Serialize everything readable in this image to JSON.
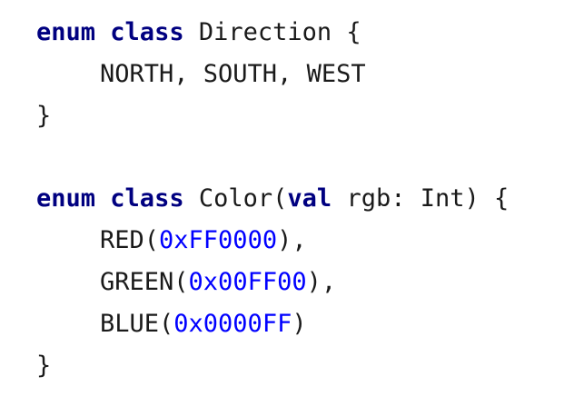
{
  "code": {
    "line1": {
      "kw_enum": "enum",
      "kw_class": "class",
      "name": "Direction",
      "brace": "{"
    },
    "line2": {
      "values": "NORTH, SOUTH, WEST"
    },
    "line3": {
      "brace": "}"
    },
    "line5": {
      "kw_enum": "enum",
      "kw_class": "class",
      "name_open": "Color(",
      "kw_val": "val",
      "param": "rgb: Int)",
      "brace": "{"
    },
    "line6": {
      "name_open": "RED(",
      "hex": "0xFF0000",
      "close": "),"
    },
    "line7": {
      "name_open": "GREEN(",
      "hex": "0x00FF00",
      "close": "),"
    },
    "line8": {
      "name_open": "BLUE(",
      "hex": "0x0000FF",
      "close": ")"
    },
    "line9": {
      "brace": "}"
    }
  },
  "colors": {
    "keyword": "#000080",
    "number": "#0000ff",
    "text": "#1a1a1a",
    "background": "#ffffff"
  }
}
